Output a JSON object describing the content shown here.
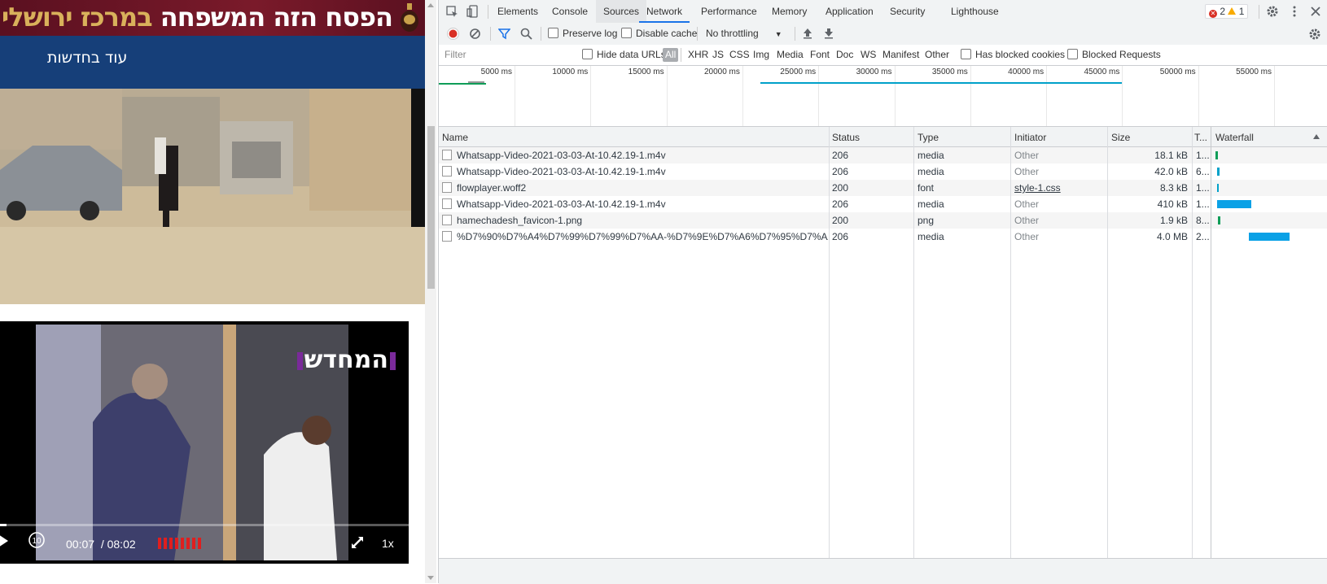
{
  "page": {
    "banner_text_white": "הפסח הזה המשפחה ",
    "banner_text_gold": "במרכז ירושלי",
    "nav_more": "עוד בחדשות",
    "video": {
      "logo": "המחדש",
      "current_time": "00:07",
      "separator": "/",
      "duration": "08:02",
      "speed": "1x",
      "progress_fraction": 0.015,
      "rewind_label": "10"
    }
  },
  "devtools": {
    "tabs": [
      "Elements",
      "Console",
      "Sources",
      "Network",
      "Performance",
      "Memory",
      "Application",
      "Security",
      "Lighthouse"
    ],
    "active_tab": "Network",
    "errors_count": "2",
    "warnings_count": "1",
    "toolbar": {
      "preserve_log": "Preserve log",
      "disable_cache": "Disable cache",
      "throttling": "No throttling"
    },
    "filter": {
      "placeholder": "Filter",
      "hide_data_urls": "Hide data URLs",
      "types": [
        "All",
        "XHR",
        "JS",
        "CSS",
        "Img",
        "Media",
        "Font",
        "Doc",
        "WS",
        "Manifest",
        "Other"
      ],
      "selected_type": "All",
      "has_blocked_cookies": "Has blocked cookies",
      "blocked_requests": "Blocked Requests"
    },
    "overview_ticks": [
      "5000 ms",
      "10000 ms",
      "15000 ms",
      "20000 ms",
      "25000 ms",
      "30000 ms",
      "35000 ms",
      "40000 ms",
      "45000 ms",
      "50000 ms",
      "55000 ms"
    ],
    "columns": {
      "name": "Name",
      "status": "Status",
      "type": "Type",
      "initiator": "Initiator",
      "size": "Size",
      "time": "T...",
      "waterfall": "Waterfall"
    },
    "rows": [
      {
        "name": "Whatsapp-Video-2021-03-03-At-10.42.19-1.m4v",
        "status": "206",
        "type": "media",
        "initiator": "Other",
        "initiator_link": false,
        "size": "18.1 kB",
        "time": "1...",
        "wf_color": "#0f9d58"
      },
      {
        "name": "Whatsapp-Video-2021-03-03-At-10.42.19-1.m4v",
        "status": "206",
        "type": "media",
        "initiator": "Other",
        "initiator_link": false,
        "size": "42.0 kB",
        "time": "6...",
        "wf_color": "#00a1c9"
      },
      {
        "name": "flowplayer.woff2",
        "status": "200",
        "type": "font",
        "initiator": "style-1.css",
        "initiator_link": true,
        "size": "8.3 kB",
        "time": "1...",
        "wf_color": "#00a1c9"
      },
      {
        "name": "Whatsapp-Video-2021-03-03-At-10.42.19-1.m4v",
        "status": "206",
        "type": "media",
        "initiator": "Other",
        "initiator_link": false,
        "size": "410 kB",
        "time": "1...",
        "wf_color": "#0aa1e6"
      },
      {
        "name": "hamechadesh_favicon-1.png",
        "status": "200",
        "type": "png",
        "initiator": "Other",
        "initiator_link": false,
        "size": "1.9 kB",
        "time": "8...",
        "wf_color": "#0f9d58"
      },
      {
        "name": "%D7%90%D7%A4%D7%99%D7%99%D7%AA-%D7%9E%D7%A6%D7%95%D7%AA.mp4",
        "status": "206",
        "type": "media",
        "initiator": "Other",
        "initiator_link": false,
        "size": "4.0 MB",
        "time": "2...",
        "wf_color": "#0aa1e6"
      }
    ]
  }
}
